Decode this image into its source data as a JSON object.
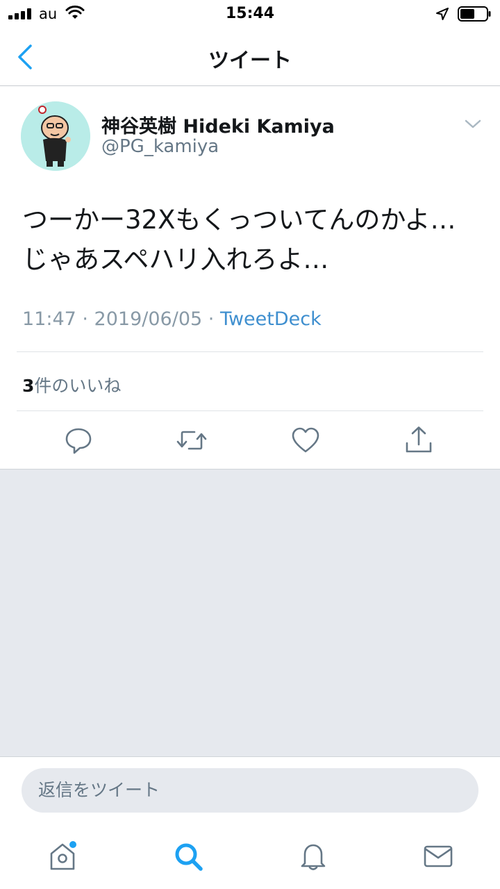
{
  "status_bar": {
    "carrier": "au",
    "time": "15:44"
  },
  "nav": {
    "title": "ツイート"
  },
  "tweet": {
    "display_name": "神谷英樹 Hideki Kamiya",
    "handle": "@PG_kamiya",
    "text": "つーかー32Xもくっついてんのかよ…\nじゃあスペハリ入れろよ…",
    "time": "11:47 · 2019/06/05 · ",
    "source": "TweetDeck",
    "likes_count": "3",
    "likes_label": "件のいいね"
  },
  "reply": {
    "placeholder": "返信をツイート"
  },
  "icons": {
    "back": "chevron-left-icon",
    "caret": "chevron-down-icon",
    "reply": "reply-icon",
    "retweet": "retweet-icon",
    "like": "heart-icon",
    "share": "share-icon",
    "home": "home-icon",
    "search": "search-icon",
    "notifications": "bell-icon",
    "messages": "mail-icon"
  },
  "colors": {
    "accent": "#1da1f2",
    "text": "#14171a",
    "secondary": "#657786",
    "background_gray": "#e6e9ee"
  }
}
